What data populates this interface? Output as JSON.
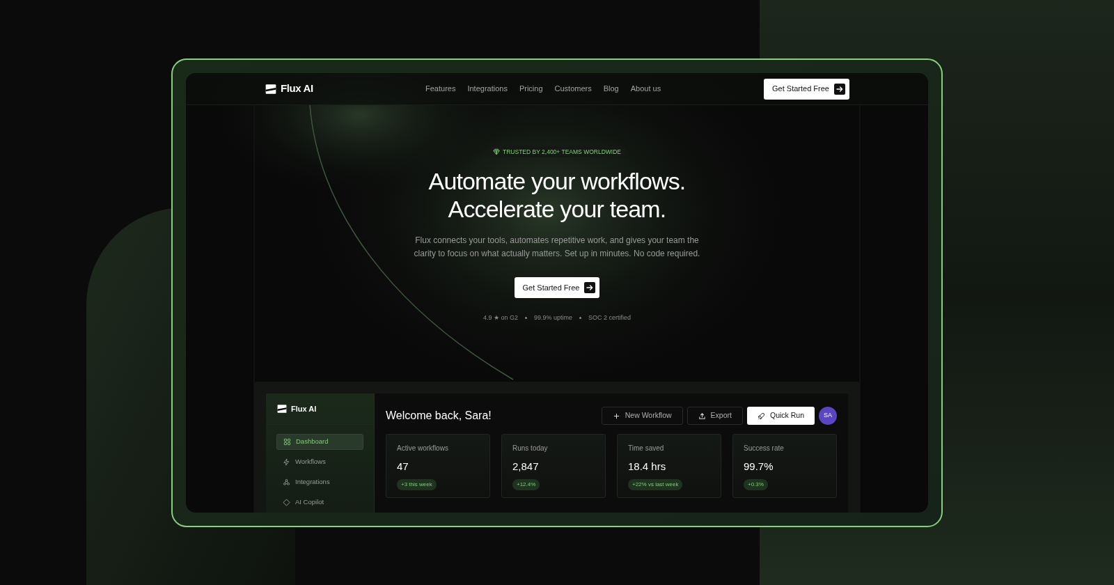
{
  "nav": {
    "brand": "Flux AI",
    "links": [
      "Features",
      "Integrations",
      "Pricing",
      "Customers",
      "Blog",
      "About us"
    ],
    "cta": "Get Started Free"
  },
  "hero": {
    "badge": "TRUSTED BY 2,400+ TEAMS WORLDWIDE",
    "title": [
      "Automate your workflows.",
      "Accelerate your team."
    ],
    "description": "Flux connects your tools, automates repetitive work, and gives your team the clarity to focus on what actually matters. Set up in minutes. No code required.",
    "cta": "Get Started Free",
    "stats": [
      "4.9 ★ on G2",
      "99.9% uptime",
      "SOC 2 certified"
    ]
  },
  "dashboard": {
    "brand": "Flux AI",
    "sidebar": {
      "items": [
        {
          "label": "Dashboard",
          "selected": true
        },
        {
          "label": "Workflows",
          "selected": false
        },
        {
          "label": "Integrations",
          "selected": false
        },
        {
          "label": "AI Copilot",
          "selected": false
        }
      ]
    },
    "welcome": "Welcome back, Sara!",
    "actions": [
      {
        "label": "New Workflow",
        "kind": "outline"
      },
      {
        "label": "Export",
        "kind": "outline"
      },
      {
        "label": "Quick Run",
        "kind": "primary"
      }
    ],
    "avatar": "SA",
    "stats": [
      {
        "label": "Active workflows",
        "value": "47",
        "change": "+3 this week"
      },
      {
        "label": "Runs today",
        "value": "2,847",
        "change": "+12.4%"
      },
      {
        "label": "Time saved",
        "value": "18.4 hrs",
        "change": "+22% vs last week"
      },
      {
        "label": "Success rate",
        "value": "99.7%",
        "change": "+0.3%"
      }
    ]
  }
}
